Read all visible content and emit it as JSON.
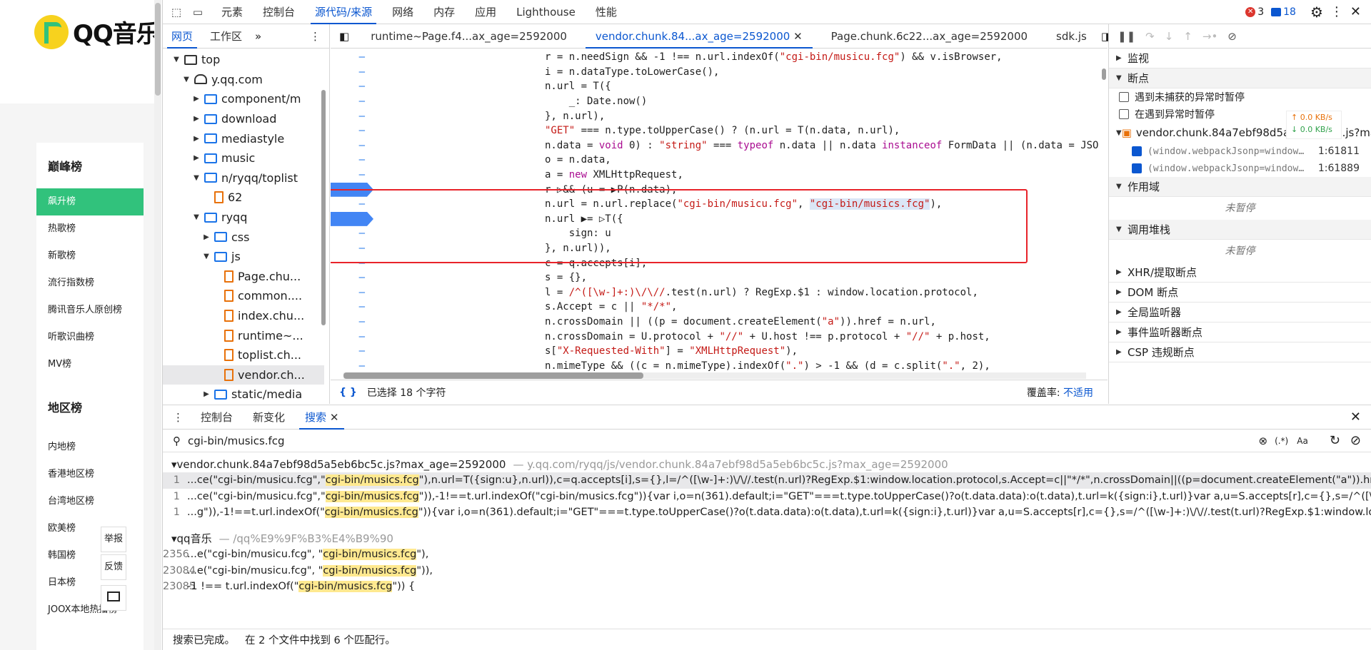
{
  "site": {
    "logo_text": "QQ音乐",
    "group1_title": "巅峰榜",
    "group1_items": [
      "飙升榜",
      "热歌榜",
      "新歌榜",
      "流行指数榜",
      "腾讯音乐人原创榜",
      "听歌识曲榜",
      "MV榜"
    ],
    "group2_title": "地区榜",
    "group2_items": [
      "内地榜",
      "香港地区榜",
      "台湾地区榜",
      "欧美榜",
      "韩国榜",
      "日本榜",
      "JOOX本地热播榜"
    ],
    "report_label": "举报",
    "feedback_label": "反馈"
  },
  "devtools": {
    "main_tabs": [
      "元素",
      "控制台",
      "源代码/来源",
      "网络",
      "内存",
      "应用",
      "Lighthouse",
      "性能"
    ],
    "error_count": "3",
    "message_count": "18",
    "nav_tabs": [
      "网页",
      "工作区"
    ],
    "tree": [
      {
        "label": "top",
        "indent": 0,
        "arrow": "▼",
        "type": "frame"
      },
      {
        "label": "y.qq.com",
        "indent": 1,
        "arrow": "▼",
        "type": "cloud"
      },
      {
        "label": "component/m",
        "indent": 2,
        "arrow": "▶",
        "type": "folder"
      },
      {
        "label": "download",
        "indent": 2,
        "arrow": "▶",
        "type": "folder"
      },
      {
        "label": "mediastyle",
        "indent": 2,
        "arrow": "▶",
        "type": "folder"
      },
      {
        "label": "music",
        "indent": 2,
        "arrow": "▶",
        "type": "folder"
      },
      {
        "label": "n/ryqq/toplist",
        "indent": 2,
        "arrow": "▼",
        "type": "folder"
      },
      {
        "label": "62",
        "indent": 3,
        "arrow": "",
        "type": "file"
      },
      {
        "label": "ryqq",
        "indent": 2,
        "arrow": "▼",
        "type": "folder"
      },
      {
        "label": "css",
        "indent": 3,
        "arrow": "▶",
        "type": "folder"
      },
      {
        "label": "js",
        "indent": 3,
        "arrow": "▼",
        "type": "folder"
      },
      {
        "label": "Page.chu...",
        "indent": 4,
        "arrow": "",
        "type": "file"
      },
      {
        "label": "common....",
        "indent": 4,
        "arrow": "",
        "type": "file"
      },
      {
        "label": "index.chu...",
        "indent": 4,
        "arrow": "",
        "type": "file"
      },
      {
        "label": "runtime~...",
        "indent": 4,
        "arrow": "",
        "type": "file"
      },
      {
        "label": "toplist.ch...",
        "indent": 4,
        "arrow": "",
        "type": "file"
      },
      {
        "label": "vendor.ch...",
        "indent": 4,
        "arrow": "",
        "type": "file",
        "selected": true
      },
      {
        "label": "static/media",
        "indent": 3,
        "arrow": "▶",
        "type": "folder"
      }
    ],
    "editor_tabs": [
      "runtime~Page.f4...ax_age=2592000",
      "vendor.chunk.84...ax_age=2592000",
      "Page.chunk.6c22...ax_age=2592000",
      "sdk.js"
    ],
    "status_selection": "已选择 18 个字符",
    "status_coverage_label": "覆盖率:",
    "status_coverage_value": "不适用",
    "debugger": {
      "watch": "监视",
      "breakpoints": "断点",
      "pause_uncaught": "遇到未捕获的异常时暂停",
      "pause_caught": "在遇到异常时暂停",
      "bp_file": "vendor.chunk.84a7ebf98d5a5eb6bc5c.js?max_age=2592000",
      "bp1_code": "(window.webpackJsonp=window…",
      "bp1_loc": "1:61811",
      "bp2_code": "(window.webpackJsonp=window…",
      "bp2_loc": "1:61889",
      "scope": "作用域",
      "not_paused": "未暂停",
      "callstack": "调用堆栈",
      "xhr": "XHR/提取断点",
      "dom": "DOM 断点",
      "global": "全局监听器",
      "event": "事件监听器断点",
      "csp": "CSP 违规断点",
      "net_up": "↑ 0.0 KB/s",
      "net_down": "↓ 0.0 KB/s"
    },
    "drawer_tabs": [
      "控制台",
      "新变化",
      "搜索"
    ],
    "search_query": "cgi-bin/musics.fcg",
    "results": [
      {
        "file": "vendor.chunk.84a7ebf98d5a5eb6bc5c.js?max_age=2592000",
        "path": "— y.qq.com/ryqq/js/vendor.chunk.84a7ebf98d5a5eb6bc5c.js?max_age=2592000",
        "lines": [
          {
            "n": "1",
            "pre": "...ce(\"cgi-bin/musicu.fcg\",\"",
            "match": "cgi-bin/musics.fcg",
            "post": "\"),n.url=T({sign:u},n.url)),c=q.accepts[i],s={},l=/^([\\w-]+:)\\/\\//.test(n.url)?RegExp.$1:window.location.protocol,s.Accept=c||\"*/*\",n.crossDomain||((p=document.createElement(\"a\")).href=n...."
          },
          {
            "n": "1",
            "pre": "...ce(\"cgi-bin/musicu.fcg\",\"",
            "match": "cgi-bin/musics.fcg",
            "post": "\")),-1!==t.url.indexOf(\"cgi-bin/musics.fcg\")){var i,o=n(361).default;i=\"GET\"===t.type.toUpperCase()?o(t.data.data):o(t.data),t.url=k({sign:i},t.url)}var a,u=S.accepts[r],c={},s=/^([\\w-]+:)\\/\\..."
          },
          {
            "n": "1",
            "pre": "...g\")),-1!==t.url.indexOf(\"",
            "match": "cgi-bin/musics.fcg",
            "post": "\")){var i,o=n(361).default;i=\"GET\"===t.type.toUpperCase()?o(t.data.data):o(t.data),t.url=k({sign:i},t.url)}var a,u=S.accepts[r],c={},s=/^([\\w-]+:)\\/\\//.test(t.url)?RegExp.$1:window.location.pr..."
          }
        ]
      },
      {
        "file": "qq音乐",
        "path": "— /qq%E9%9F%B3%E4%B9%90",
        "lines": [
          {
            "n": "2356",
            "pre": "...e(\"cgi-bin/musicu.fcg\", \"",
            "match": "cgi-bin/musics.fcg",
            "post": "\"),"
          },
          {
            "n": "23084",
            "pre": "...e(\"cgi-bin/musicu.fcg\", \"",
            "match": "cgi-bin/musics.fcg",
            "post": "\")),"
          },
          {
            "n": "23085",
            "pre": "-1 !== t.url.indexOf(\"",
            "match": "cgi-bin/musics.fcg",
            "post": "\")) {"
          }
        ]
      }
    ],
    "search_done": "搜索已完成。",
    "search_summary": "在 2 个文件中找到 6 个匹配行。"
  }
}
